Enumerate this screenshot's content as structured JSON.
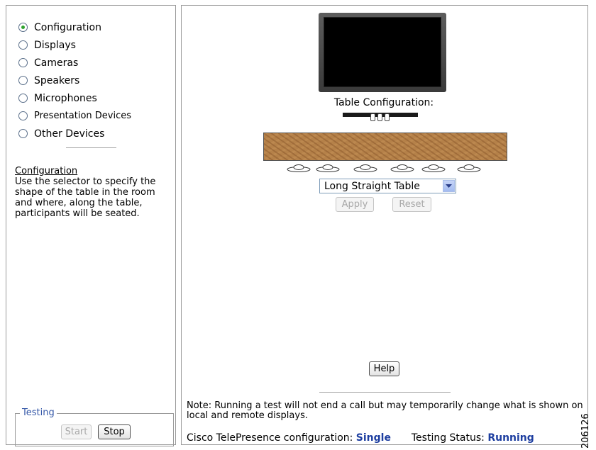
{
  "nav": {
    "items": [
      {
        "label": "Configuration",
        "selected": true
      },
      {
        "label": "Displays",
        "selected": false
      },
      {
        "label": "Cameras",
        "selected": false
      },
      {
        "label": "Speakers",
        "selected": false
      },
      {
        "label": "Microphones",
        "selected": false
      },
      {
        "label": "Presentation Devices",
        "selected": false
      },
      {
        "label": "Other Devices",
        "selected": false
      }
    ]
  },
  "description": {
    "title": "Configuration",
    "text": "Use the selector to specify the shape of the table in the room and where, along the table, participants will be seated."
  },
  "testing": {
    "legend": "Testing",
    "start_label": "Start",
    "stop_label": "Stop"
  },
  "main": {
    "table_config_label": "Table Configuration:",
    "table_select_value": "Long Straight Table",
    "apply_label": "Apply",
    "reset_label": "Reset",
    "help_label": "Help",
    "seat_count": 6
  },
  "footer": {
    "note": "Note: Running a test will not end a call but may temporarily change what is shown on local and remote displays.",
    "config_label": "Cisco TelePresence configuration:",
    "config_value": "Single",
    "status_label": "Testing Status:",
    "status_value": "Running"
  },
  "figure_id": "206126",
  "colors": {
    "accent_text": "#1d3ea0",
    "legend_text": "#3558a8",
    "radio_selected": "#2ea22e"
  }
}
